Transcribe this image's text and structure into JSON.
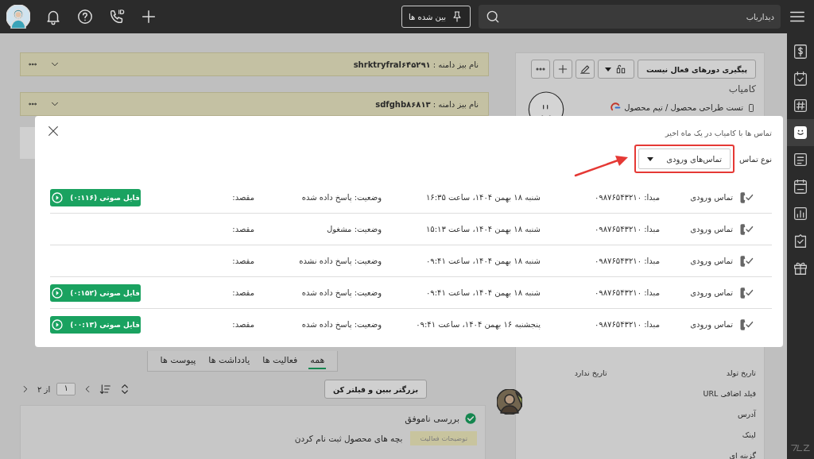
{
  "topbar": {
    "search": {
      "placeholder": "دیداریاب"
    },
    "pinned_button": "بین شده ها"
  },
  "sidebar": {
    "items": [
      {
        "selected": false
      },
      {
        "selected": false
      },
      {
        "selected": false
      },
      {
        "selected": true
      },
      {
        "selected": false
      },
      {
        "selected": false
      },
      {
        "selected": false
      },
      {
        "selected": false
      },
      {
        "selected": false
      }
    ]
  },
  "domains": [
    {
      "label": "نام بیز دامنه :",
      "value": "shrktryfral۶۴۵۲۹۱"
    },
    {
      "label": "نام بیز دامنه :",
      "value": "sdfghb۸۶۸۱۳"
    }
  ],
  "contact": {
    "follow_button": "پیگیری دورهای فعال نیست",
    "name": "کامیاب",
    "subtitle": "تست طراحی محصول / تیم محصول",
    "fields": [
      {
        "label": "تاریخ تولد",
        "value": "تاریخ ندارد"
      },
      {
        "label": "فیلد اضافی URL"
      },
      {
        "label": "آدرس"
      },
      {
        "label": "لینک"
      },
      {
        "label": "گزینه ای"
      }
    ]
  },
  "tabs": [
    {
      "label": "همه",
      "selected": true
    },
    {
      "label": "فعالیت ها",
      "selected": false
    },
    {
      "label": "یادداشت ها",
      "selected": false
    },
    {
      "label": "پیوست ها",
      "selected": false
    }
  ],
  "toolbar": {
    "filter_button": "بزرگتر ببین و فیلتر کن",
    "page": "۱",
    "of_pages": "از ۲"
  },
  "activity": {
    "title": "بررسی ناموفق",
    "done": true,
    "tag": "توضیحات فعالیت",
    "text": "بچه های محصول ثبت نام کردن"
  },
  "modal": {
    "title": "تماس ها با کامیاب در یک ماه اخیر",
    "filter_label": "نوع تماس",
    "filter_value": "تماس‌های ورودی",
    "highlighted": true,
    "rows": [
      {
        "type": "تماس ورودی",
        "origin": "مبدا: ۰۹۸۷۶۵۴۳۲۱۰",
        "date": "شنبه ۱۸ بهمن ۱۴۰۴، ساعت ۱۶:۳۵",
        "status": "وضعیت: پاسخ داده شده",
        "destination": "مقصد:",
        "recording": "فایل صوتی (۰:۱۱۶)"
      },
      {
        "type": "تماس ورودی",
        "origin": "مبدا: ۰۹۸۷۶۵۴۳۲۱۰",
        "date": "شنبه ۱۸ بهمن ۱۴۰۴، ساعت ۱۵:۱۳",
        "status": "وضعیت: مشغول",
        "destination": "مقصد:"
      },
      {
        "type": "تماس ورودی",
        "origin": "مبدا: ۰۹۸۷۶۵۴۳۲۱۰",
        "date": "شنبه ۱۸ بهمن ۱۴۰۴، ساعت ۰۹:۴۱",
        "status": "وضعیت: پاسخ داده نشده",
        "destination": "مقصد:"
      },
      {
        "type": "تماس ورودی",
        "origin": "مبدا: ۰۹۸۷۶۵۴۳۲۱۰",
        "date": "شنبه ۱۸ بهمن ۱۴۰۴، ساعت ۰۹:۴۱",
        "status": "وضعیت: پاسخ داده شده",
        "destination": "مقصد:",
        "recording": "فایل صوتی (۰:۱۵۲)"
      },
      {
        "type": "تماس ورودی",
        "origin": "مبدا: ۰۹۸۷۶۵۴۳۲۱۰",
        "date": "پنجشنبه ۱۶ بهمن ۱۴۰۴، ساعت ۰۹:۴۱",
        "status": "وضعیت: پاسخ داده شده",
        "destination": "مقصد:",
        "recording": "فایل صوتی (۰۰:۱۳)"
      }
    ]
  }
}
